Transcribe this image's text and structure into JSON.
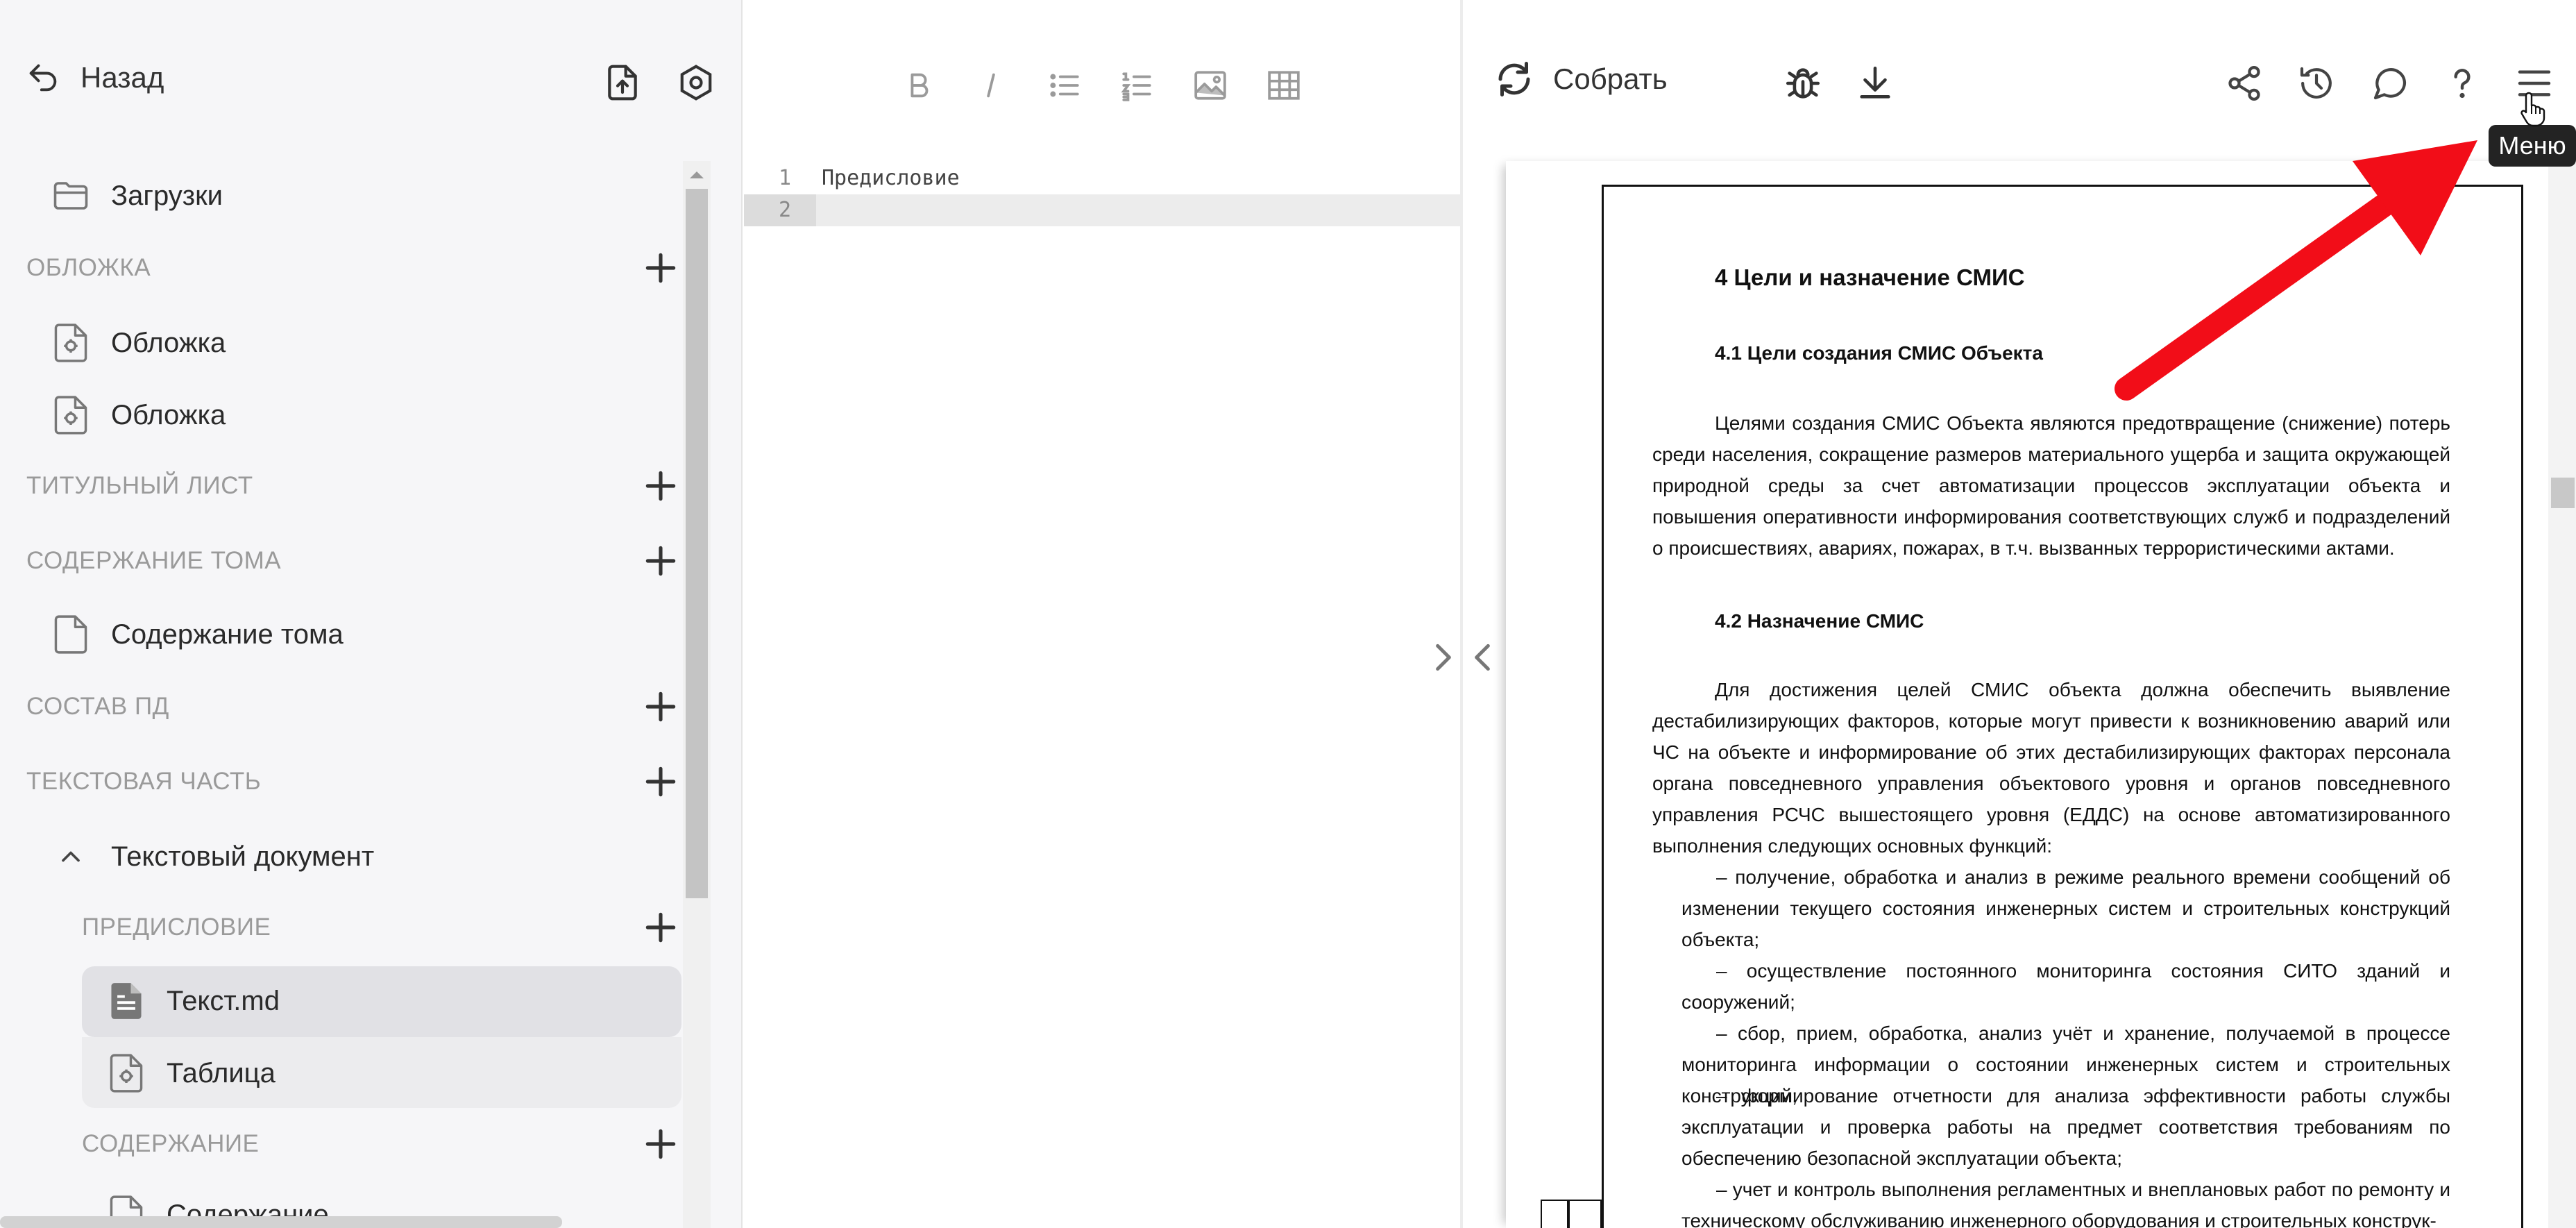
{
  "sidebar": {
    "back_label": "Назад",
    "downloads_label": "Загрузки",
    "sections": {
      "cover": "ОБЛОЖКА",
      "title_page": "ТИТУЛЬНЫЙ ЛИСТ",
      "volume_contents": "СОДЕРЖАНИЕ ТОМА",
      "pd_composition": "СОСТАВ ПД",
      "text_part": "ТЕКСТОВАЯ ЧАСТЬ",
      "preface": "ПРЕДИСЛОВИЕ",
      "contents": "СОДЕРЖАНИЕ"
    },
    "items": {
      "cover_1": "Обложка",
      "cover_2": "Обложка",
      "volume_contents": "Содержание тома",
      "text_document": "Текстовый документ",
      "text_md": "Текст.md",
      "table": "Таблица",
      "contents_partial": "Содержание"
    }
  },
  "editor": {
    "line_numbers": [
      "1",
      "2"
    ],
    "lines": [
      "Предисловие",
      ""
    ]
  },
  "preview": {
    "build_label": "Собрать",
    "tooltip": "Меню",
    "document": {
      "h1": "4  Цели и назначение СМИС",
      "h2_1": "4.1  Цели создания СМИС Объекта",
      "p1": "Целями создания СМИС Объекта являются предотвращение (снижение) потерь среди населения, сокращение размеров материального ущерба и защита окружающей природной среды за счет автоматизации процессов эксплуатации объекта и повышения оперативности информирования соответствующих служб и подразделений о происшествиях, авариях, пожарах, в т.ч. вызванных террористическими актами.",
      "h2_2": "4.2  Назначение СМИС",
      "p2": "Для достижения целей СМИС объекта должна обеспечить выявление дестабилизирующих факторов, которые могут привести к возникновению аварий или ЧС на объекте и информирование об этих дестабилизирующих факторах персонала органа повседневного управления объектового уровня и органов повседневного управления РСЧС вышестоящего уровня (ЕДДС) на основе автоматизированного выполнения следующих основных функций:",
      "bullets": [
        "–  получение, обработка и анализ в режиме реального времени сообщений об изменении текущего состояния инженерных систем и строительных конструкций объекта;",
        "–  осуществление постоянного мониторинга состояния СИТО зданий и сооружений;",
        "–  сбор, прием, обработка, анализ учёт и хранение, получаемой в процессе мониторинга информации о состоянии инженерных систем и строительных конструкций;",
        "–  формирование отчетности для анализа эффективности работы службы эксплуатации и проверка работы на предмет соответствия требованиям по обеспечению безопасной эксплуатации объекта;",
        "–  учет и контроль выполнения регламентных и внеплановых работ по ремонту и техническому обслуживанию инженерного оборудования и строительных конструк-"
      ]
    }
  },
  "colors": {
    "arrow": "#f20d18",
    "sidebar_bg": "#f6f6f8",
    "selected_bg": "#e1e1e5",
    "section_text": "#9a9a9a"
  }
}
